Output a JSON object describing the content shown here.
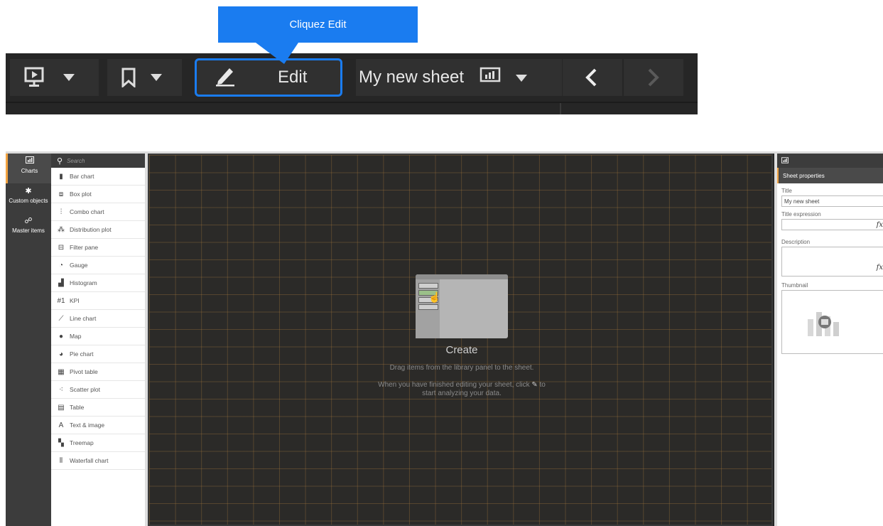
{
  "callout": {
    "text": "Cliquez Edit"
  },
  "toolbar": {
    "edit_label": "Edit",
    "sheet_name": "My new sheet",
    "icons": [
      "present-icon",
      "dropdown-icon",
      "bookmark-icon",
      "dropdown-icon",
      "pencil-icon",
      "chart-icon",
      "dropdown-icon",
      "chevron-left-icon",
      "chevron-right-icon"
    ]
  },
  "leftnav": {
    "items": [
      {
        "label": "Charts",
        "icon": "chart-icon"
      },
      {
        "label": "Custom objects",
        "icon": "puzzle-icon"
      },
      {
        "label": "Master items",
        "icon": "link-icon"
      }
    ]
  },
  "library": {
    "search_placeholder": "Search",
    "items": [
      {
        "label": "Bar chart",
        "icon": "bar-chart-icon"
      },
      {
        "label": "Box plot",
        "icon": "box-plot-icon"
      },
      {
        "label": "Combo chart",
        "icon": "combo-chart-icon"
      },
      {
        "label": "Distribution plot",
        "icon": "distribution-plot-icon"
      },
      {
        "label": "Filter pane",
        "icon": "filter-pane-icon"
      },
      {
        "label": "Gauge",
        "icon": "gauge-icon"
      },
      {
        "label": "Histogram",
        "icon": "histogram-icon"
      },
      {
        "label": "KPI",
        "icon": "kpi-icon"
      },
      {
        "label": "Line chart",
        "icon": "line-chart-icon"
      },
      {
        "label": "Map",
        "icon": "map-icon"
      },
      {
        "label": "Pie chart",
        "icon": "pie-chart-icon"
      },
      {
        "label": "Pivot table",
        "icon": "pivot-table-icon"
      },
      {
        "label": "Scatter plot",
        "icon": "scatter-plot-icon"
      },
      {
        "label": "Table",
        "icon": "table-icon"
      },
      {
        "label": "Text & image",
        "icon": "text-image-icon"
      },
      {
        "label": "Treemap",
        "icon": "treemap-icon"
      },
      {
        "label": "Waterfall chart",
        "icon": "waterfall-chart-icon"
      }
    ]
  },
  "canvas": {
    "title": "Create",
    "line1": "Drag items from the library panel to the sheet.",
    "line2a": "When you have finished editing your sheet, click",
    "line2b": "to",
    "line3": "start analyzing your data."
  },
  "props": {
    "header": "Sheet properties",
    "title_label": "Title",
    "title_value": "My new sheet",
    "title_expr_label": "Title expression",
    "description_label": "Description",
    "thumbnail_label": "Thumbnail",
    "fx": "fx"
  },
  "colors": {
    "accent": "#1a7cf0",
    "orange": "#f2a341",
    "dark": "#262626"
  }
}
